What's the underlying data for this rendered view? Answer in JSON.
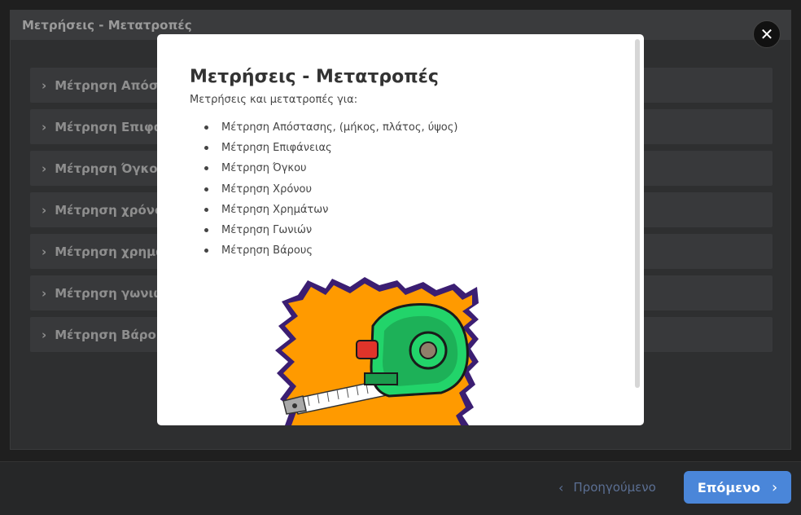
{
  "background": {
    "title": "Μετρήσεις - Μετατροπές",
    "items": [
      "Μέτρηση Απόσ",
      "Μέτρηση Επιφα",
      "Μέτρηση Όγκο",
      "Μέτρηση χρόνο",
      "Μέτρηση χρημα",
      "Μέτρηση γωνιω",
      "Μέτρηση Βάρου"
    ]
  },
  "modal": {
    "title": "Μετρήσεις - Μετατροπές",
    "intro": "Μετρήσεις και μετατροπές για:",
    "list": [
      "Μέτρηση Απόστασης, (μήκος, πλάτος, ύψος)",
      "Μέτρηση Επιφάνειας",
      "Μέτρηση Όγκου",
      "Μέτρηση Χρόνου",
      "Μέτρηση Χρημάτων",
      "Μέτρηση Γωνιών",
      "Μέτρηση Βάρους"
    ],
    "image_icon": "tape-measure-icon"
  },
  "nav": {
    "prev_label": "Προηγούμενο",
    "next_label": "Επόμενο"
  },
  "colors": {
    "accent": "#4a86d9",
    "tape_green": "#22d46a",
    "burst_orange": "#ff9a00"
  }
}
